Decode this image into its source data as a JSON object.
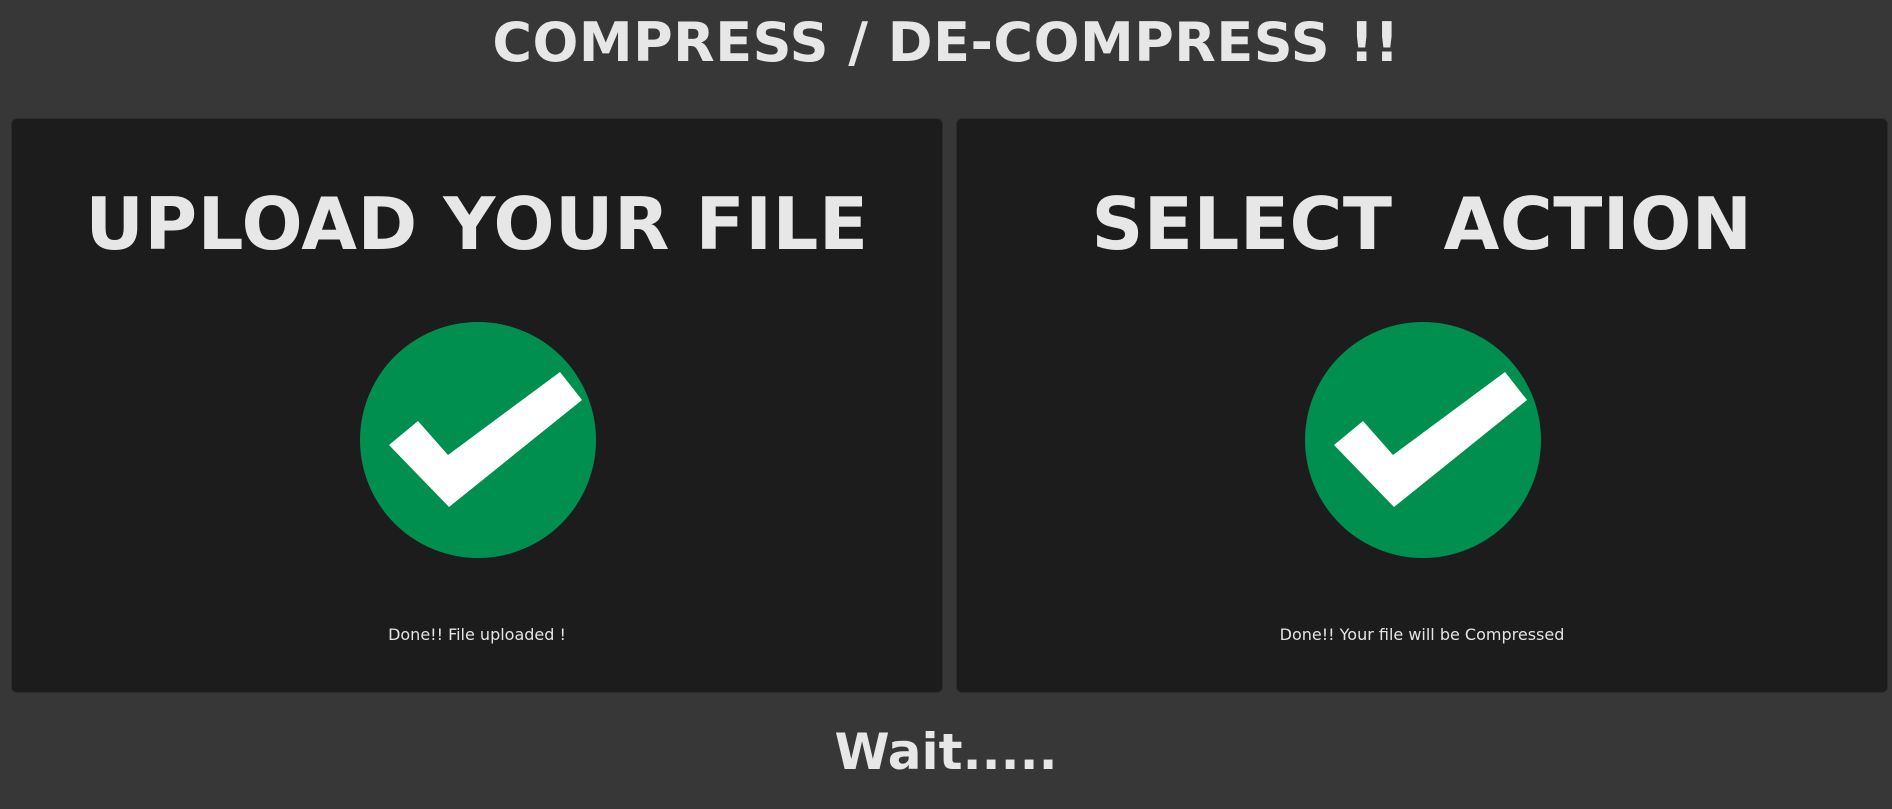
{
  "header": {
    "title": "COMPRESS / DE-COMPRESS !!"
  },
  "colors": {
    "page_background": "#373737",
    "panel_background": "#1c1c1c",
    "text": "#e7e7e7",
    "success_green": "#008f4f",
    "check_white": "#ffffff"
  },
  "panels": [
    {
      "heading": "UPLOAD YOUR FILE",
      "icon": "check-circle-icon",
      "status": "Done!! File uploaded !"
    },
    {
      "heading": "SELECT  ACTION",
      "icon": "check-circle-icon",
      "status": "Done!! Your file will be Compressed"
    }
  ],
  "footer": {
    "message": "Wait....."
  }
}
